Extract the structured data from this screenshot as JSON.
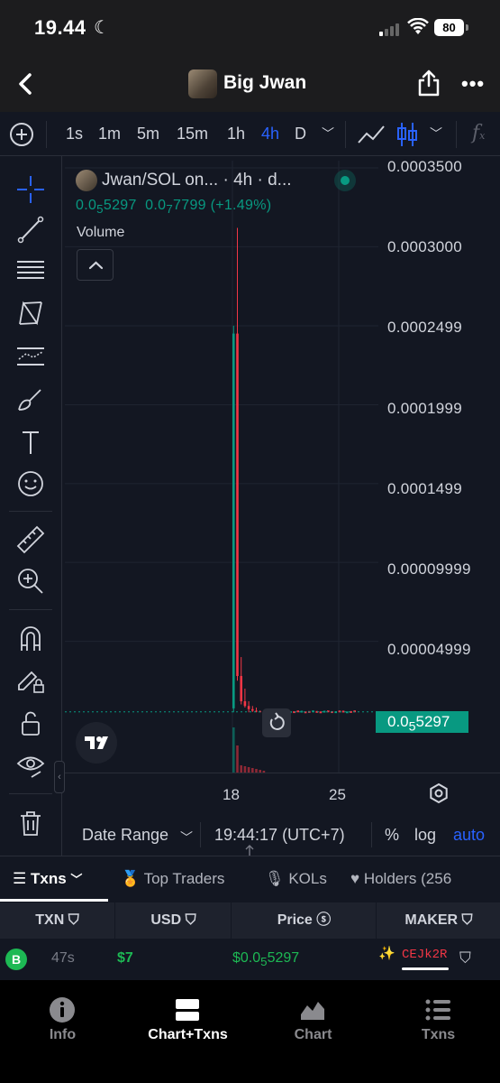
{
  "status": {
    "time": "19.44",
    "battery": "80"
  },
  "header": {
    "title": "Big Jwan"
  },
  "toolbar": {
    "intervals": [
      "1s",
      "1m",
      "5m",
      "15m",
      "1h",
      "4h",
      "D"
    ],
    "active_interval": "4h"
  },
  "legend": {
    "name": "Jwan/SOL on... · 4h · d...",
    "open_html": "0.0<sub>5</sub>5297",
    "change_html": "0.0<sub>7</sub>7799 (+1.49%)",
    "volume": "Volume"
  },
  "price_scale": {
    "labels": [
      "0.0003500",
      "0.0003000",
      "0.0002499",
      "0.0001999",
      "0.0001499",
      "0.00009999",
      "0.00004999"
    ],
    "current_price_html": "0.0<sub>5</sub>5297"
  },
  "time_axis": {
    "labels": [
      "18",
      "25"
    ]
  },
  "range_bar": {
    "date_range": "Date Range",
    "clock": "19:44:17 (UTC+7)",
    "percent": "%",
    "log": "log",
    "auto": "auto"
  },
  "txn_tabs": {
    "txns": "Txns",
    "top_traders": "Top Traders",
    "kols": "KOLs",
    "holders": "Holders (256"
  },
  "table": {
    "headers": [
      "TXN",
      "USD",
      "Price",
      "MAKER"
    ],
    "rows": [
      {
        "type": "B",
        "age": "47s",
        "usd": "$7",
        "price_html": "$0.0<sub>5</sub>5297",
        "maker": "CEJk2R"
      }
    ]
  },
  "bottom_nav": {
    "items": [
      "Info",
      "Chart+Txns",
      "Chart",
      "Txns"
    ],
    "active": "Chart+Txns"
  },
  "colors": {
    "up": "#089981",
    "down": "#f23645",
    "accent": "#2962ff",
    "background": "#131722"
  },
  "chart_data": {
    "type": "candlestick",
    "ylabels": [
      "0.0003500",
      "0.0003000",
      "0.0002499",
      "0.0001999",
      "0.0001499",
      "0.00009999",
      "0.00004999"
    ],
    "ylim": [
      0,
      0.00035
    ],
    "candles": [
      {
        "open": 7.5e-06,
        "high": 0.00025,
        "low": 5e-06,
        "close": 0.000245,
        "dir": "up"
      },
      {
        "open": 0.000245,
        "high": 0.000312,
        "low": 2.5e-05,
        "close": 2.8e-05,
        "dir": "down"
      },
      {
        "open": 2.8e-05,
        "high": 4e-05,
        "low": 1e-05,
        "close": 1.2e-05,
        "dir": "down"
      },
      {
        "open": 1.2e-05,
        "high": 2e-05,
        "low": 8e-06,
        "close": 9e-06,
        "dir": "down"
      },
      {
        "open": 9e-06,
        "high": 1.2e-05,
        "low": 5e-06,
        "close": 7e-06,
        "dir": "down"
      },
      {
        "open": 7e-06,
        "high": 9e-06,
        "low": 5.2e-06,
        "close": 6e-06,
        "dir": "down"
      },
      {
        "open": 6e-06,
        "high": 8e-06,
        "low": 5e-06,
        "close": 5.6e-06,
        "dir": "down"
      },
      {
        "open": 5.6e-06,
        "high": 6.2e-06,
        "low": 5.2e-06,
        "close": 5.4e-06,
        "dir": "down"
      },
      {
        "open": 5.4e-06,
        "high": 5.8e-06,
        "low": 5.2e-06,
        "close": 5.3e-06,
        "dir": "down"
      }
    ],
    "current_price": 5.297e-06,
    "time_labels": [
      "18",
      "25"
    ],
    "grid": true
  }
}
